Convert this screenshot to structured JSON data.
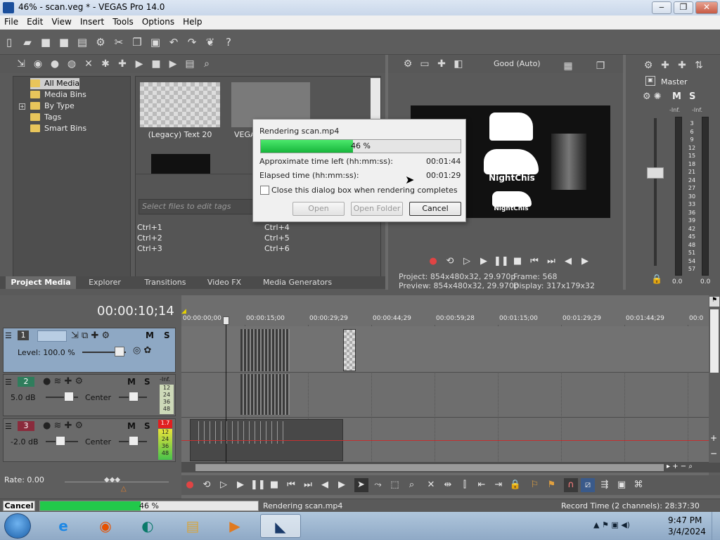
{
  "window": {
    "title": "46% - scan.veg * - VEGAS Pro 14.0",
    "min": "‒",
    "max": "❐",
    "close": "✕"
  },
  "menu": [
    "File",
    "Edit",
    "View",
    "Insert",
    "Tools",
    "Options",
    "Help"
  ],
  "tree": [
    "All Media",
    "Media Bins",
    "By Type",
    "Tags",
    "Smart Bins"
  ],
  "media": {
    "thumb1_label": "(Legacy) Text 20",
    "thumb2_label": "VEGA",
    "tags_placeholder": "Select files to edit tags",
    "shortcuts": [
      "Ctrl+1",
      "Ctrl+2",
      "Ctrl+3",
      "Ctrl+4",
      "Ctrl+5",
      "Ctrl+6"
    ]
  },
  "tabs": [
    "Project Media",
    "Explorer",
    "Transitions",
    "Video FX",
    "Media Generators"
  ],
  "dialog": {
    "title": "Rendering scan.mp4",
    "progress_text": "46 %",
    "progress": 0.46,
    "time_left_label": "Approximate time left (hh:mm:ss):",
    "time_left": "00:01:44",
    "elapsed_label": "Elapsed time (hh:mm:ss):",
    "elapsed": "00:01:29",
    "checkbox_label": "Close this dialog box when rendering completes",
    "open": "Open",
    "open_folder": "Open Folder",
    "cancel": "Cancel"
  },
  "preview": {
    "quality": "Good (Auto)",
    "project_label": "Project:",
    "project": "854x480x32, 29.970p",
    "preview_label": "Preview:",
    "preview": "854x480x32, 29.970p",
    "frame_label": "Frame:",
    "frame": "568",
    "display_label": "Display:",
    "display": "317x179x32",
    "video_text_1": "NightChis",
    "video_text_2": "NightChis",
    "video_text_3": "NightChis"
  },
  "master": {
    "label": "Master",
    "inf_left": "-Inf.",
    "inf_right": "-Inf.",
    "scale": [
      "3",
      "6",
      "9",
      "12",
      "15",
      "18",
      "21",
      "24",
      "27",
      "30",
      "33",
      "36",
      "39",
      "42",
      "45",
      "48",
      "51",
      "54",
      "57"
    ],
    "bottom_left": "0.0",
    "bottom_right": "0.0"
  },
  "timeline": {
    "timecode": "00:00:10;14",
    "ruler": [
      "00:00:00;00",
      "00:00:15;00",
      "00:00:29;29",
      "00:00:44;29",
      "00:00:59;28",
      "00:01:15;00",
      "00:01:29;29",
      "00:01:44;29",
      "00:0"
    ],
    "tracks": [
      {
        "num": "1",
        "level": "Level: 100.0 %"
      },
      {
        "num": "2",
        "vol": "5.0 dB",
        "pan": "Center",
        "meter_top": "-Inf."
      },
      {
        "num": "3",
        "vol": "-2.0 dB",
        "pan": "Center",
        "meter_top": "1.7"
      }
    ],
    "meter_scale": [
      "12",
      "24",
      "36",
      "48"
    ],
    "rate": "Rate: 0.00"
  },
  "status": {
    "cancel": "Cancel",
    "progress_text": "46 %",
    "progress": 0.46,
    "rendering": "Rendering scan.mp4",
    "record_time": "Record Time (2 channels): 28:37:30"
  },
  "taskbar": {
    "time": "9:47 PM",
    "date": "3/4/2024"
  },
  "colors": {
    "progress_green": "#22c94a",
    "dark_bg": "#5a5a5a",
    "track_selected": "#8ea8c4"
  }
}
